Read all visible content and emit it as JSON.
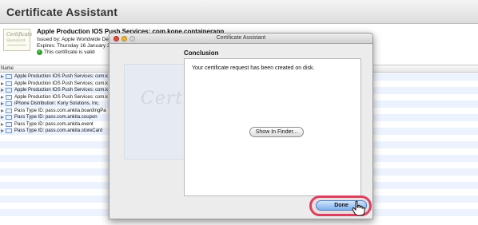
{
  "app": {
    "title": "Certificate Assistant"
  },
  "selected_certificate": {
    "thumbnail_word": "Certificate",
    "thumbnail_sub": "Standard",
    "name": "Apple Production IOS Push Services: com.kone.containerapp",
    "issued_by": "Issued by: Apple Worldwide Devo",
    "expires": "Expires: Thursday 16 January 20",
    "validity": "This certificate is valid"
  },
  "certificate_list": {
    "column_name": "Name",
    "rows": [
      "Apple Production IOS Push Services: com.k",
      "Apple Production IOS Push Services: com.k",
      "Apple Production IOS Push Services: com.k",
      "Apple Production IOS Push Services: com.k",
      "iPhone Distribution: Kony Solutions, Inc.",
      "Pass Type ID: pass.com.ankita.boardingPa",
      "Pass Type ID: pass.com.ankita.coupon",
      "Pass Type ID: pass.com.ankita.event",
      "Pass Type ID: pass.com.ankita.storeCard"
    ]
  },
  "dialog": {
    "title": "Certificate Assistant",
    "watermark_word": "Certificate",
    "heading": "Conclusion",
    "message": "Your certificate request has been created on disk.",
    "show_in_finder_label": "Show In Finder...",
    "done_label": "Done"
  },
  "colors": {
    "highlight_ring": "#d9415f",
    "default_button": "#7fb0ef",
    "row_alt": "#edf3fe"
  }
}
